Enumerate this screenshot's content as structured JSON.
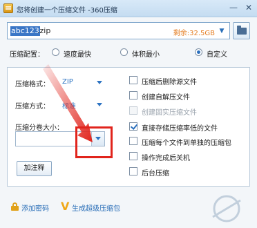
{
  "window": {
    "title": "您将创建一个压缩文件 -360压缩",
    "minimize_glyph": "—",
    "close_glyph": "✕"
  },
  "path": {
    "selected_part": "abc123",
    "rest": ".zip",
    "free_space": "剩余:32.5GB"
  },
  "config": {
    "label": "压缩配置：",
    "options": [
      {
        "label": "速度最快",
        "checked": false
      },
      {
        "label": "体积最小",
        "checked": false
      },
      {
        "label": "自定义",
        "checked": true
      }
    ]
  },
  "left_options": {
    "format_label": "压缩格式：",
    "format_value": "ZIP",
    "method_label": "压缩方式：",
    "method_value": "标准",
    "split_label": "压缩分卷大小：",
    "split_value": "",
    "comment_button": "加注释"
  },
  "right_options": [
    {
      "label": "压缩后删除源文件",
      "checked": false,
      "disabled": false
    },
    {
      "label": "创建自解压文件",
      "checked": false,
      "disabled": false
    },
    {
      "label": "创建固实压缩文件",
      "checked": false,
      "disabled": true
    },
    {
      "label": "直接存储压缩率低的文件",
      "checked": true,
      "disabled": false
    },
    {
      "label": "压缩每个文件到单独的压缩包",
      "checked": false,
      "disabled": false
    },
    {
      "label": "操作完成后关机",
      "checked": false,
      "disabled": false
    },
    {
      "label": "后台压缩",
      "checked": false,
      "disabled": false
    }
  ],
  "bottom": {
    "add_password": "添加密码",
    "super_package": "生成超级压缩包"
  },
  "colors": {
    "accent": "#2e74c2",
    "free_space": "#e47b1d",
    "annotation_red": "#e1241c"
  }
}
